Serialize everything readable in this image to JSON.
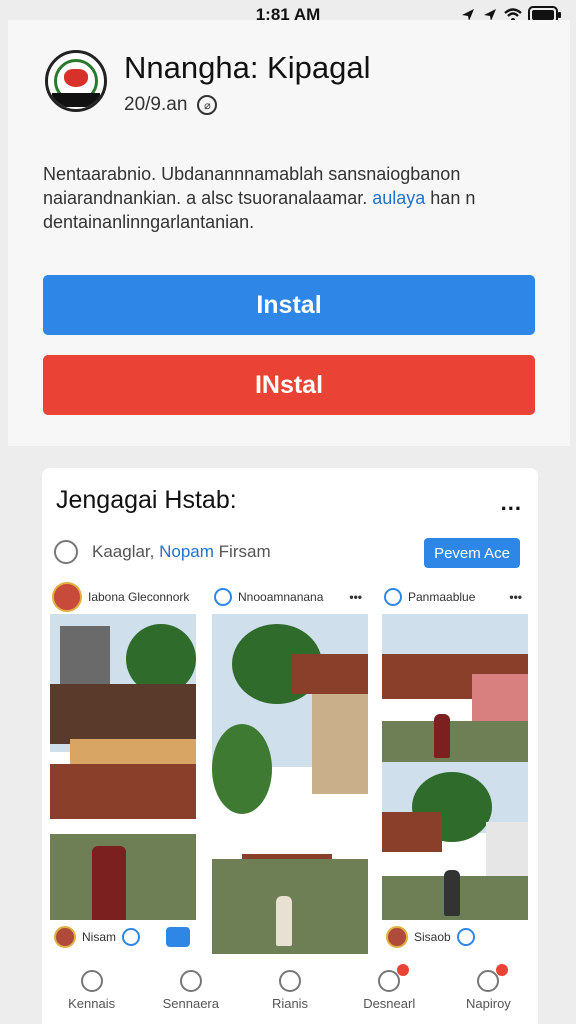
{
  "status_bar": {
    "time": "1:81 AM",
    "icons": [
      "location-icon",
      "location-icon",
      "wifi-icon",
      "battery-icon"
    ]
  },
  "app": {
    "title": "Nnangha: Kipagal",
    "meta": "20/9.an",
    "description_line1": "Nentaarabnio. Ubdanannnamablah sansnaiogbanon",
    "description_line2_part1": "naiarandnankian. a alsc tsuoranalaamar.",
    "description_link": "aulaya",
    "description_line2_part2": "han n",
    "description_line3": "dentainanlinngarlantanian.",
    "install_button_1": "Instal",
    "install_button_2": "INstal",
    "colors": {
      "primary": "#2e86e6",
      "danger": "#ea4335",
      "link": "#2472c8"
    }
  },
  "feed": {
    "title": "Jengagai Hstab:",
    "more_icon": "...",
    "search_prefix": "Kaaglar,",
    "search_highlight": "Nopam",
    "search_suffix": "Firsam",
    "follow_button": "Pevem Ace",
    "posts": [
      {
        "author": "Iabona Gleconnork",
        "footer_name": "Nisam"
      },
      {
        "author": "Nnooamnanana",
        "footer_name": ""
      },
      {
        "author": "Panmaablue",
        "footer_name": "Sisaob"
      }
    ]
  },
  "tabs": [
    {
      "label": "Kennais",
      "icon": "home-icon"
    },
    {
      "label": "Sennaera",
      "icon": "search-icon"
    },
    {
      "label": "Rianis",
      "icon": "profile-icon"
    },
    {
      "label": "Desnearl",
      "icon": "user-icon"
    },
    {
      "label": "Napiroy",
      "icon": "heart-icon"
    }
  ]
}
